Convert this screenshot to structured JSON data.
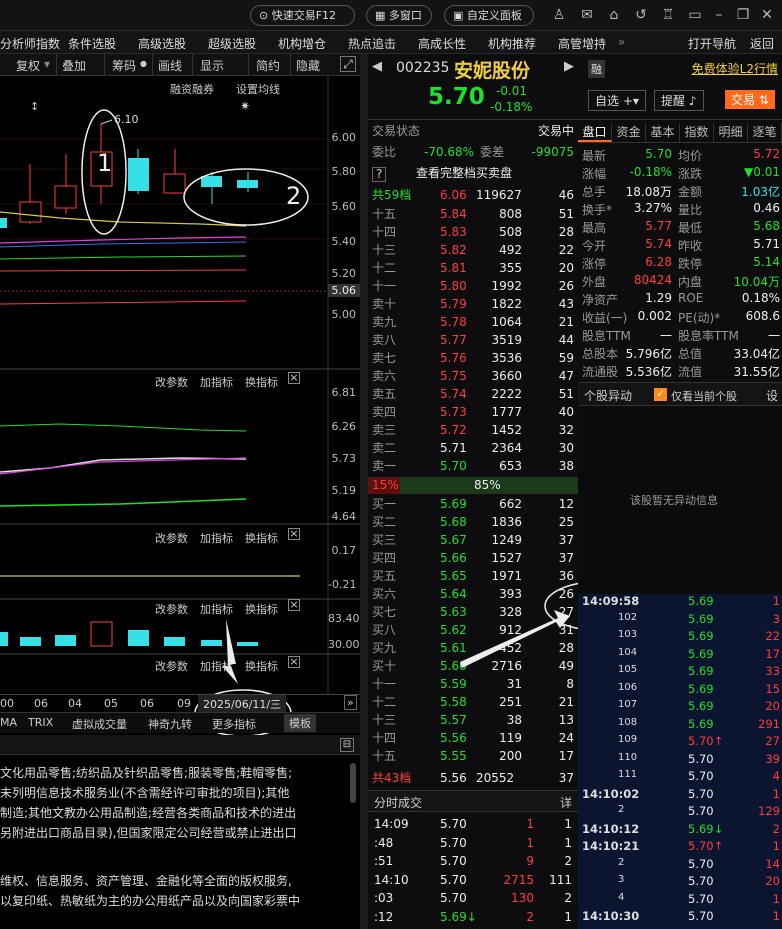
{
  "topbar": {
    "quick_trade": "快速交易F12",
    "multi_window": "多窗口",
    "custom_panel": "自定义面板"
  },
  "menubar": {
    "items": [
      "分析师指数",
      "条件选股",
      "高级选股",
      "超级选股",
      "机构增仓",
      "热点追击",
      "高成长性",
      "机构推荐",
      "高管增持"
    ],
    "more": "»",
    "open_nav": "打开导航",
    "back": "返回"
  },
  "chart_toolbar": {
    "items": [
      "复权",
      "叠加",
      "筹码",
      "画线",
      "显示",
      "简约",
      "隐藏"
    ]
  },
  "chart": {
    "sub_labels": [
      "融资融券",
      "设置均线"
    ],
    "annotation_high": "6.10",
    "main_axis": [
      "6.00",
      "5.80",
      "5.60",
      "5.40",
      "5.20",
      "5.06",
      "5.00"
    ],
    "panel2": {
      "labels": [
        "改参数",
        "加指标",
        "换指标"
      ],
      "axis": [
        "6.81",
        "6.26",
        "5.73",
        "5.19",
        "4.64"
      ]
    },
    "panel3": {
      "labels": [
        "改参数",
        "加指标",
        "换指标"
      ],
      "axis": [
        "0.17",
        "-0.21"
      ]
    },
    "panel4": {
      "labels": [
        "改参数",
        "加指标",
        "换指标"
      ],
      "axis": [
        "83.40",
        "30.00"
      ]
    },
    "panel5": {
      "labels": [
        "改参数",
        "加指标",
        "换指标"
      ]
    },
    "x_axis": [
      "00",
      "06",
      "04",
      "05",
      "06",
      "09"
    ],
    "date_tag": "2025/06/11/三",
    "tabs": [
      "MA",
      "TRIX",
      "虚拟成交量",
      "神奇九转",
      "更多指标",
      "模板"
    ],
    "callouts": [
      "1",
      "2"
    ]
  },
  "business": {
    "lines": [
      "文化用品零售;纺织品及针织品零售;服装零售;鞋帽零售;",
      "未列明信息技术服务业(不含需经许可审批的项目);其他",
      "制造;其他文教办公用品制造;经营各类商品和技术的进出",
      "另附进出口商品目录),但国家限定公司经营或禁止进出口",
      "",
      "维权、信息服务、资产管理、金融化等全面的版权服务,",
      "以复印纸、热敏纸为主的办公用纸产品以及向国家彩票中"
    ]
  },
  "stock": {
    "code": "002235",
    "name": "安妮股份",
    "tag": "融",
    "promo": "免费体验L2行情",
    "price": "5.70",
    "change": "-0.01",
    "change_pct": "-0.18%",
    "self_select": "自选",
    "remind": "提醒",
    "trade": "交易"
  },
  "orderbook": {
    "status_label": "交易状态",
    "status_value": "交易中",
    "weibi_label": "委比",
    "weibi": "-70.68%",
    "weicha_label": "委差",
    "weicha": "-99075",
    "full_label": "查看完整档买卖盘",
    "sell_total": {
      "label": "共59档",
      "price": "6.06",
      "vol": "119627",
      "n": "46"
    },
    "asks": [
      [
        "十五",
        "5.84",
        "808",
        "51"
      ],
      [
        "十四",
        "5.83",
        "508",
        "28"
      ],
      [
        "十三",
        "5.82",
        "492",
        "22"
      ],
      [
        "十二",
        "5.81",
        "355",
        "20"
      ],
      [
        "十一",
        "5.80",
        "1992",
        "26"
      ],
      [
        "卖十",
        "5.79",
        "1822",
        "43"
      ],
      [
        "卖九",
        "5.78",
        "1064",
        "21"
      ],
      [
        "卖八",
        "5.77",
        "3519",
        "44"
      ],
      [
        "卖七",
        "5.76",
        "3536",
        "59"
      ],
      [
        "卖六",
        "5.75",
        "3660",
        "47"
      ],
      [
        "卖五",
        "5.74",
        "2222",
        "51"
      ],
      [
        "卖四",
        "5.73",
        "1777",
        "40"
      ],
      [
        "卖三",
        "5.72",
        "1452",
        "32"
      ],
      [
        "卖二",
        "5.71",
        "2364",
        "30"
      ],
      [
        "卖一",
        "5.70",
        "653",
        "38"
      ]
    ],
    "ratio_sell": "15%",
    "ratio_buy": "85%",
    "bids": [
      [
        "买一",
        "5.69",
        "662",
        "12"
      ],
      [
        "买二",
        "5.68",
        "1836",
        "25"
      ],
      [
        "买三",
        "5.67",
        "1249",
        "37"
      ],
      [
        "买四",
        "5.66",
        "1527",
        "37"
      ],
      [
        "买五",
        "5.65",
        "1971",
        "36"
      ],
      [
        "买六",
        "5.64",
        "393",
        "26"
      ],
      [
        "买七",
        "5.63",
        "328",
        "27"
      ],
      [
        "买八",
        "5.62",
        "912",
        "31"
      ],
      [
        "买九",
        "5.61",
        "452",
        "28"
      ],
      [
        "买十",
        "5.60",
        "2716",
        "49"
      ],
      [
        "十一",
        "5.59",
        "31",
        "8"
      ],
      [
        "十二",
        "5.58",
        "251",
        "21"
      ],
      [
        "十三",
        "5.57",
        "38",
        "13"
      ],
      [
        "十四",
        "5.56",
        "119",
        "24"
      ],
      [
        "十五",
        "5.55",
        "200",
        "17"
      ]
    ],
    "buy_total": {
      "label": "共43档",
      "price": "5.56",
      "vol": "20552",
      "n": "37"
    },
    "trades_title": "分时成交",
    "trades_more": "详",
    "trades": [
      [
        "14:09",
        "5.70",
        "1",
        "1"
      ],
      [
        ":48",
        "5.70",
        "1",
        "1"
      ],
      [
        ":51",
        "5.70",
        "9",
        "2"
      ],
      [
        "14:10",
        "5.70",
        "2715",
        "111"
      ],
      [
        ":03",
        "5.70",
        "130",
        "2"
      ],
      [
        ":12",
        "5.69↓",
        "2",
        "1"
      ]
    ]
  },
  "panel": {
    "tabs": [
      "盘口",
      "资金",
      "基本",
      "指数",
      "明细",
      "逐笔"
    ],
    "stats": [
      [
        "最新",
        "5.70",
        "均价",
        "5.72"
      ],
      [
        "涨幅",
        "-0.18%",
        "涨跌",
        "▼0.01"
      ],
      [
        "总手",
        "18.08万",
        "金额",
        "1.03亿"
      ],
      [
        "换手*",
        "3.27%",
        "量比",
        "0.46"
      ],
      [
        "最高",
        "5.77",
        "最低",
        "5.68"
      ],
      [
        "今开",
        "5.74",
        "昨收",
        "5.71"
      ],
      [
        "涨停",
        "6.28",
        "跌停",
        "5.14"
      ],
      [
        "外盘",
        "80424",
        "内盘",
        "10.04万"
      ],
      [
        "净资产",
        "1.29",
        "ROE",
        "0.18%"
      ],
      [
        "收益(一)",
        "0.002",
        "PE(动)*",
        "608.6"
      ],
      [
        "股息TTM",
        "一",
        "股息率TTM",
        "一"
      ],
      [
        "总股本",
        "5.796亿",
        "总值",
        "33.04亿"
      ],
      [
        "流通股",
        "5.536亿",
        "流值",
        "31.55亿"
      ]
    ],
    "alert_title": "个股异动",
    "alert_check": "仅看当前个股",
    "alert_set": "设",
    "alert_empty": "该股暂无异动信息",
    "ticks": [
      [
        "14:09:58",
        "5.69",
        "1"
      ],
      [
        "102",
        "5.69",
        "3"
      ],
      [
        "103",
        "5.69",
        "22"
      ],
      [
        "104",
        "5.69",
        "17"
      ],
      [
        "105",
        "5.69",
        "33"
      ],
      [
        "106",
        "5.69",
        "15"
      ],
      [
        "107",
        "5.69",
        "20"
      ],
      [
        "108",
        "5.69",
        "291"
      ],
      [
        "109",
        "5.70↑",
        "27"
      ],
      [
        "110",
        "5.70",
        "39"
      ],
      [
        "111",
        "5.70",
        "4"
      ],
      [
        "14:10:02",
        "5.70",
        "1"
      ],
      [
        "2",
        "5.70",
        "129"
      ],
      [
        "14:10:12",
        "5.69↓",
        "2"
      ],
      [
        "14:10:21",
        "5.70↑",
        "1"
      ],
      [
        "2",
        "5.70",
        "14"
      ],
      [
        "3",
        "5.70",
        "20"
      ],
      [
        "4",
        "5.70",
        "1"
      ],
      [
        "14:10:30",
        "5.70",
        "1"
      ]
    ]
  }
}
